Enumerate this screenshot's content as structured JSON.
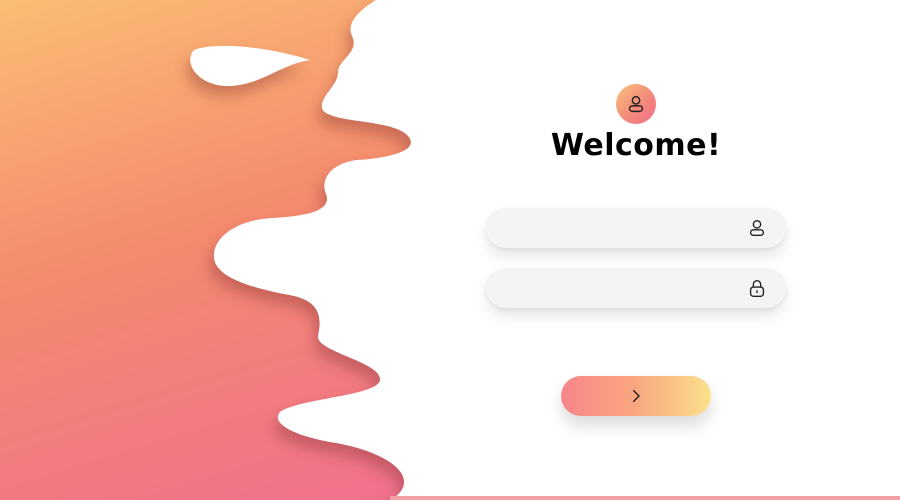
{
  "colors": {
    "gradient_top": "#fbbd74",
    "gradient_mid": "#f48a6e",
    "gradient_bottom": "#ef6e90",
    "button_start": "#f7858a",
    "button_end": "#fbe08c",
    "field_bg": "#f4f4f4"
  },
  "header": {
    "avatar_icon": "user-icon",
    "title": "Welcome!"
  },
  "form": {
    "username": {
      "value": "",
      "placeholder": "",
      "icon": "user-icon"
    },
    "password": {
      "value": "",
      "placeholder": "",
      "icon": "lock-icon"
    },
    "submit": {
      "label": "",
      "icon": "chevron-right-icon"
    }
  }
}
